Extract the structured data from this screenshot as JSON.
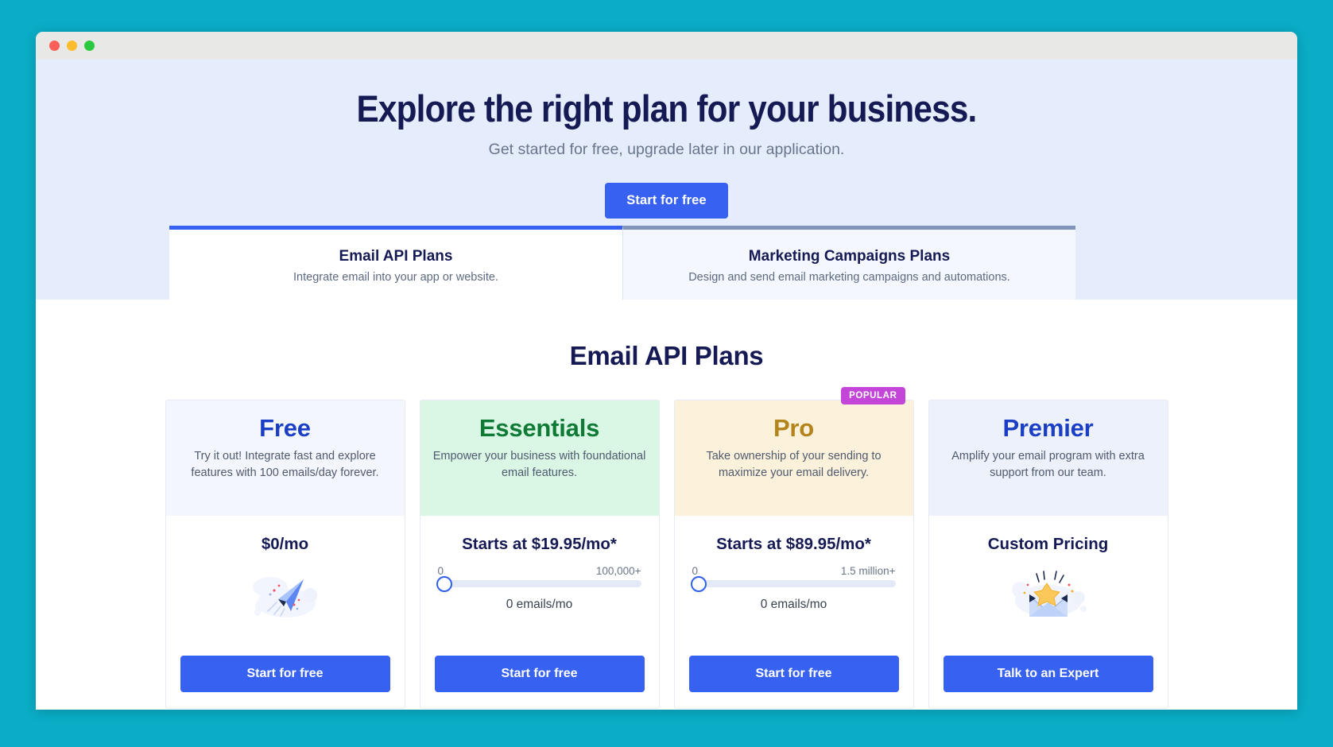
{
  "window": {
    "traffic_lights": [
      "close",
      "minimize",
      "maximize"
    ]
  },
  "hero": {
    "title": "Explore the right plan for your business.",
    "subtitle": "Get started for free, upgrade later in our application.",
    "cta_label": "Start for free"
  },
  "tabs": [
    {
      "id": "email-api",
      "title": "Email API Plans",
      "description": "Integrate email into your app or website.",
      "active": true
    },
    {
      "id": "marketing-campaigns",
      "title": "Marketing Campaigns Plans",
      "description": "Design and send email marketing campaigns and automations.",
      "active": false
    }
  ],
  "section": {
    "title": "Email API Plans"
  },
  "plans": [
    {
      "name": "Free",
      "accent": "#1b3fc4",
      "header_bg": "#f3f6fc",
      "description": "Try it out! Integrate fast and explore features with 100 emails/day forever.",
      "price": "$0/mo",
      "badge": null,
      "illustration": "paper-plane-illustration",
      "slider": null,
      "cta_label": "Start for free"
    },
    {
      "name": "Essentials",
      "accent": "#0e7a35",
      "header_bg": "#d9f7e4",
      "description": "Empower your business with foundational email features.",
      "price": "Starts at $19.95/mo*",
      "badge": null,
      "illustration": null,
      "slider": {
        "min_label": "0",
        "max_label": "100,000+",
        "value_label": "0 emails/mo",
        "position_percent": 0
      },
      "cta_label": "Start for free"
    },
    {
      "name": "Pro",
      "accent": "#b3841b",
      "header_bg": "#fcf1db",
      "description": "Take ownership of your sending to maximize your email delivery.",
      "price": "Starts at $89.95/mo*",
      "badge": "POPULAR",
      "illustration": null,
      "slider": {
        "min_label": "0",
        "max_label": "1.5 million+",
        "value_label": "0 emails/mo",
        "position_percent": 0
      },
      "cta_label": "Start for free"
    },
    {
      "name": "Premier",
      "accent": "#1b3fc4",
      "header_bg": "#ecf1fb",
      "description": "Amplify your email program with extra support from our team.",
      "price": "Custom Pricing",
      "badge": null,
      "illustration": "envelope-star-illustration",
      "slider": null,
      "cta_label": "Talk to an Expert"
    }
  ],
  "colors": {
    "page_frame": "#0aacc6",
    "hero_bg": "#e5ecfb",
    "primary_button": "#3761f0",
    "heading_navy": "#161a54",
    "badge_magenta": "#c446d8",
    "active_tab_border": "#3761f0",
    "inactive_tab_border": "#8193b8"
  }
}
